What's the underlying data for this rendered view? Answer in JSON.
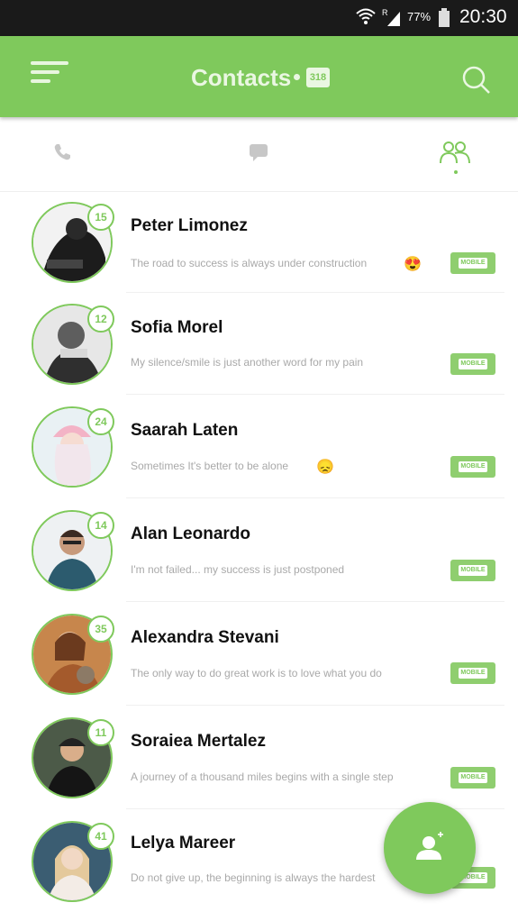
{
  "status_bar": {
    "battery": "77%",
    "time": "20:30",
    "wifi_icon": "wifi-icon",
    "signal_icon": "signal-icon",
    "battery_icon": "battery-icon"
  },
  "app_bar": {
    "title": "Contacts",
    "count": "318",
    "menu_icon": "hamburger-menu-icon",
    "search_icon": "search-icon"
  },
  "tabs": [
    {
      "icon": "phone-icon"
    },
    {
      "icon": "chat-icon"
    },
    {
      "icon": "contacts-icon",
      "active": true
    }
  ],
  "contacts": [
    {
      "name": "Peter Limonez",
      "status": "The road to success is always under construction",
      "age": "15",
      "emoji": "😍",
      "badge": "MOBILE"
    },
    {
      "name": "Sofia Morel",
      "status": "My silence/smile is just another word for my pain",
      "age": "12",
      "emoji": "",
      "badge": "MOBILE"
    },
    {
      "name": "Saarah Laten",
      "status": "Sometimes It's better to be alone",
      "age": "24",
      "emoji": "😞",
      "badge": "MOBILE"
    },
    {
      "name": "Alan Leonardo",
      "status": "I'm not failed... my success is just postponed",
      "age": "14",
      "emoji": "",
      "badge": "MOBILE"
    },
    {
      "name": "Alexandra Stevani",
      "status": "The only way to do great work is to love what you do",
      "age": "35",
      "emoji": "",
      "badge": "MOBILE"
    },
    {
      "name": "Soraiea Mertalez",
      "status": "A journey of a thousand miles begins with a single step",
      "age": "11",
      "emoji": "",
      "badge": "MOBILE"
    },
    {
      "name": "Lelya Mareer",
      "status": "Do not give up, the beginning is always the hardest",
      "age": "41",
      "emoji": "",
      "badge": "MOBILE"
    }
  ],
  "fab": {
    "icon": "add-contact-icon"
  },
  "colors": {
    "accent": "#7fc95c",
    "status_bar": "#1a1a1a"
  }
}
